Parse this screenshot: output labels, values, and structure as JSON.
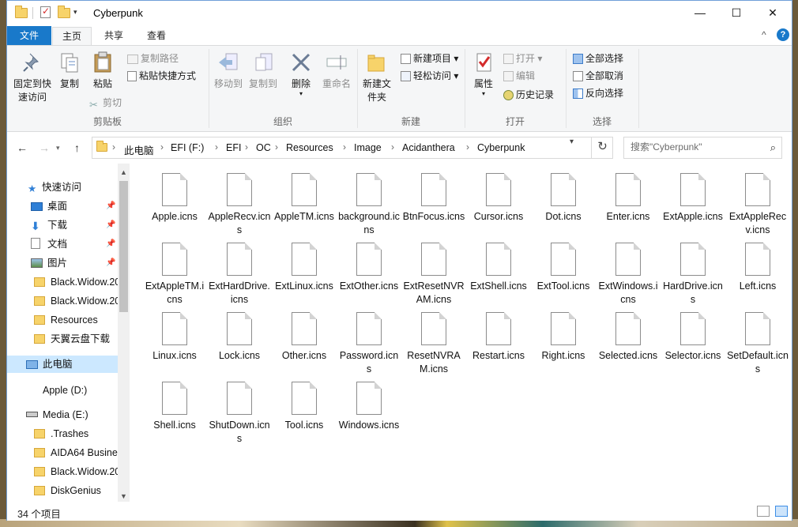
{
  "window": {
    "title": "Cyberpunk"
  },
  "title_controls": {
    "minimize": "—",
    "maximize": "☐",
    "close": "✕"
  },
  "ribbon_tabs": [
    "文件",
    "主页",
    "共享",
    "查看"
  ],
  "ribbon": {
    "clipboard": {
      "label": "剪贴板",
      "pin": "固定到快速访问",
      "copy": "复制",
      "paste": "粘贴",
      "copy_path": "复制路径",
      "paste_shortcut": "粘贴快捷方式",
      "cut": "剪切"
    },
    "organize": {
      "label": "组织",
      "move_to": "移动到",
      "copy_to": "复制到",
      "delete": "删除",
      "rename": "重命名"
    },
    "new": {
      "label": "新建",
      "new_folder": "新建文件夹",
      "new_item": "新建项目",
      "easy_access": "轻松访问"
    },
    "open": {
      "label": "打开",
      "properties": "属性",
      "open": "打开",
      "edit": "编辑",
      "history": "历史记录"
    },
    "select": {
      "label": "选择",
      "select_all": "全部选择",
      "select_none": "全部取消",
      "invert": "反向选择"
    },
    "collapse": "^",
    "help": "?"
  },
  "address": {
    "crumbs": [
      "此电脑",
      "EFI (F:)",
      "EFI",
      "OC",
      "Resources",
      "Image",
      "Acidanthera",
      "Cyberpunk"
    ],
    "search_placeholder": "搜索\"Cyberpunk\""
  },
  "nav": {
    "quick_access": "快速访问",
    "items": [
      {
        "label": "桌面",
        "pinned": true
      },
      {
        "label": "下载",
        "pinned": true
      },
      {
        "label": "文档",
        "pinned": true
      },
      {
        "label": "图片",
        "pinned": true
      },
      {
        "label": "Black.Widow.20"
      },
      {
        "label": "Black.Widow.20"
      },
      {
        "label": "Resources"
      },
      {
        "label": "天翼云盘下载"
      }
    ],
    "this_pc": "此电脑",
    "drive_apple": "Apple (D:)",
    "drive_media": "Media (E:)",
    "media_items": [
      ".Trashes",
      "AIDA64 Busine",
      "Black.Widow.20",
      "DiskGenius"
    ]
  },
  "files": [
    "Apple.icns",
    "AppleRecv.icns",
    "AppleTM.icns",
    "background.icns",
    "BtnFocus.icns",
    "Cursor.icns",
    "Dot.icns",
    "Enter.icns",
    "ExtApple.icns",
    "ExtAppleRecv.icns",
    "ExtAppleTM.icns",
    "ExtHardDrive.icns",
    "ExtLinux.icns",
    "ExtOther.icns",
    "ExtResetNVRAM.icns",
    "ExtShell.icns",
    "ExtTool.icns",
    "ExtWindows.icns",
    "HardDrive.icns",
    "Left.icns",
    "Linux.icns",
    "Lock.icns",
    "Other.icns",
    "Password.icns",
    "ResetNVRAM.icns",
    "Restart.icns",
    "Right.icns",
    "Selected.icns",
    "Selector.icns",
    "SetDefault.icns",
    "Shell.icns",
    "ShutDown.icns",
    "Tool.icns",
    "Windows.icns"
  ],
  "status": {
    "count": "34 个项目"
  }
}
